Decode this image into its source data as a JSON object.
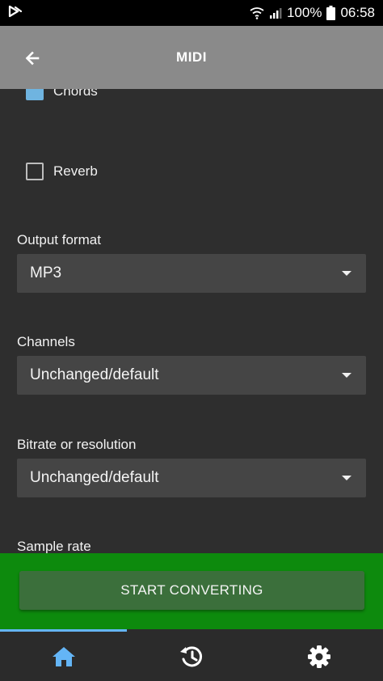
{
  "status_bar": {
    "battery_percent": "100%",
    "time": "06:58"
  },
  "app_bar": {
    "title": "MIDI"
  },
  "options": {
    "chords_label": "Chords",
    "chords_checked": true,
    "reverb_label": "Reverb",
    "reverb_checked": false
  },
  "fields": {
    "output_format": {
      "label": "Output format",
      "value": "MP3"
    },
    "channels": {
      "label": "Channels",
      "value": "Unchanged/default"
    },
    "bitrate": {
      "label": "Bitrate or resolution",
      "value": "Unchanged/default"
    },
    "sample_rate": {
      "label": "Sample rate"
    }
  },
  "convert": {
    "button_label": "START CONVERTING"
  },
  "bottom_nav": {
    "items": [
      "home-icon",
      "history-icon",
      "settings-icon"
    ],
    "active_index": 0
  },
  "colors": {
    "status_bar": "#000000",
    "app_bar": "#8a8a8a",
    "background": "#2e2e2e",
    "select_bg": "#454545",
    "checkbox_checked": "#6fb4e0",
    "convert_panel": "#0d8a0d",
    "convert_button": "#3b6f3b",
    "nav_active": "#64b5f6"
  }
}
